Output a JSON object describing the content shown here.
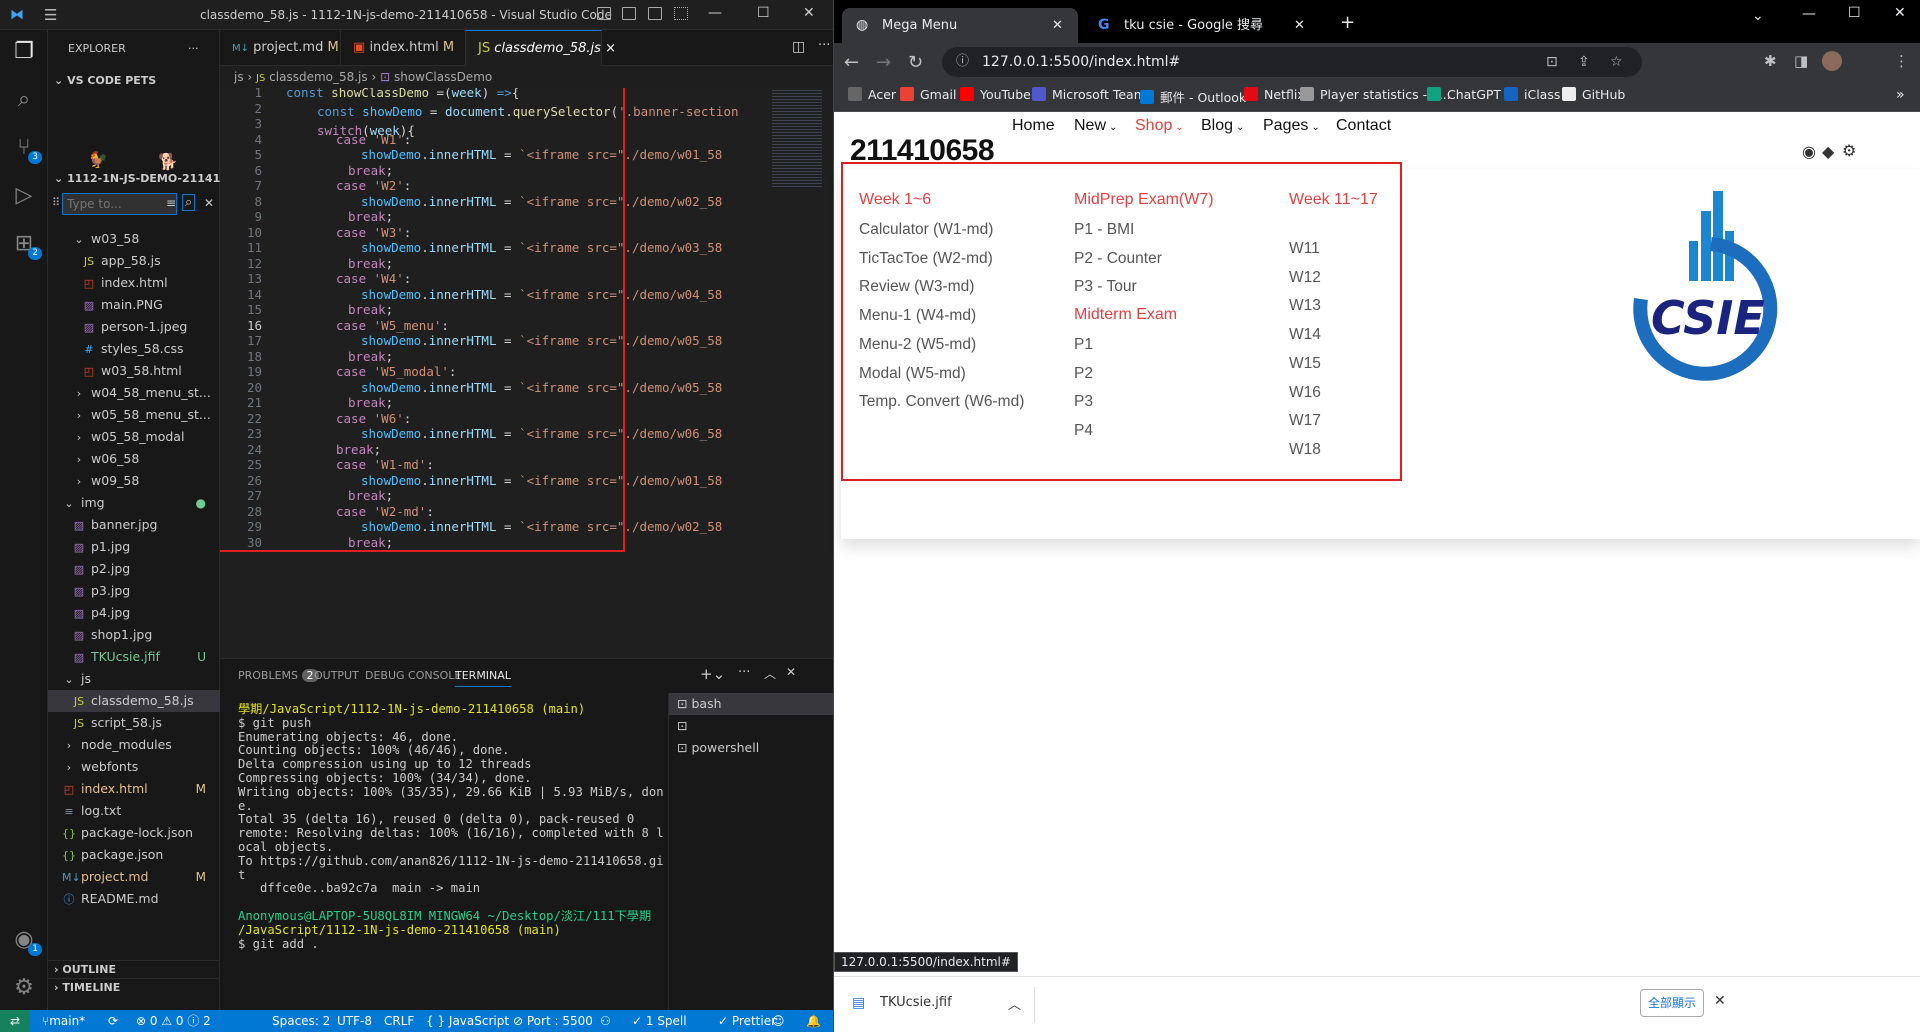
{
  "vscode": {
    "title": "classdemo_58.js - 1112-1N-js-demo-211410658 - Visual Studio Code",
    "explorer": {
      "header": "EXPLORER",
      "more": "···",
      "section": "VS CODE PETS",
      "project": "1112-1N-JS-DEMO-21141...",
      "filter_placeholder": "Type to...",
      "tree": [
        {
          "label": "w03_58",
          "type": "folder-open",
          "indent": 1,
          "mark": ""
        },
        {
          "label": "app_58.js",
          "type": "js",
          "indent": 2,
          "mark": ""
        },
        {
          "label": "index.html",
          "type": "html",
          "indent": 2,
          "mark": ""
        },
        {
          "label": "main.PNG",
          "type": "img",
          "indent": 2,
          "mark": ""
        },
        {
          "label": "person-1.jpeg",
          "type": "img",
          "indent": 2,
          "mark": ""
        },
        {
          "label": "styles_58.css",
          "type": "css",
          "indent": 2,
          "mark": ""
        },
        {
          "label": "w03_58.html",
          "type": "html",
          "indent": 2,
          "mark": ""
        },
        {
          "label": "w04_58_menu_st...",
          "type": "folder",
          "indent": 1,
          "mark": ""
        },
        {
          "label": "w05_58_menu_st...",
          "type": "folder",
          "indent": 1,
          "mark": ""
        },
        {
          "label": "w05_58_modal",
          "type": "folder",
          "indent": 1,
          "mark": ""
        },
        {
          "label": "w06_58",
          "type": "folder",
          "indent": 1,
          "mark": ""
        },
        {
          "label": "w09_58",
          "type": "folder",
          "indent": 1,
          "mark": ""
        },
        {
          "label": "img",
          "type": "folder-open",
          "indent": 0,
          "mark": "●"
        },
        {
          "label": "banner.jpg",
          "type": "img",
          "indent": 1,
          "mark": ""
        },
        {
          "label": "p1.jpg",
          "type": "img",
          "indent": 1,
          "mark": ""
        },
        {
          "label": "p2.jpg",
          "type": "img",
          "indent": 1,
          "mark": ""
        },
        {
          "label": "p3.jpg",
          "type": "img",
          "indent": 1,
          "mark": ""
        },
        {
          "label": "p4.jpg",
          "type": "img",
          "indent": 1,
          "mark": ""
        },
        {
          "label": "shop1.jpg",
          "type": "img",
          "indent": 1,
          "mark": ""
        },
        {
          "label": "TKUcsie.jfif",
          "type": "img",
          "indent": 1,
          "mark": "U"
        },
        {
          "label": "js",
          "type": "folder-open",
          "indent": 0,
          "mark": ""
        },
        {
          "label": "classdemo_58.js",
          "type": "js",
          "indent": 1,
          "mark": "",
          "sel": true
        },
        {
          "label": "script_58.js",
          "type": "js",
          "indent": 1,
          "mark": ""
        },
        {
          "label": "node_modules",
          "type": "folder",
          "indent": 0,
          "mark": ""
        },
        {
          "label": "webfonts",
          "type": "folder",
          "indent": 0,
          "mark": ""
        },
        {
          "label": "index.html",
          "type": "html",
          "indent": 0,
          "mark": "M"
        },
        {
          "label": "log.txt",
          "type": "txt",
          "indent": 0,
          "mark": ""
        },
        {
          "label": "package-lock.json",
          "type": "json",
          "indent": 0,
          "mark": ""
        },
        {
          "label": "package.json",
          "type": "json",
          "indent": 0,
          "mark": ""
        },
        {
          "label": "project.md",
          "type": "md",
          "indent": 0,
          "mark": "M"
        },
        {
          "label": "README.md",
          "type": "info",
          "indent": 0,
          "mark": ""
        }
      ],
      "outline": "OUTLINE",
      "timeline": "TIMELINE"
    },
    "tabs": [
      {
        "label": "project.md",
        "mark": "M"
      },
      {
        "label": "index.html",
        "mark": "M"
      },
      {
        "label": "classdemo_58.js",
        "mark": "×"
      }
    ],
    "breadcrumb": {
      "a": "js",
      "b": "classdemo_58.js",
      "c": "showClassDemo"
    },
    "code_lines": [
      "1",
      "2",
      "3",
      "4",
      "5",
      "6",
      "7",
      "8",
      "9",
      "10",
      "11",
      "12",
      "13",
      "14",
      "15",
      "16",
      "17",
      "18",
      "19",
      "20",
      "21",
      "22",
      "23",
      "24",
      "25",
      "26",
      "27",
      "28",
      "29",
      "30"
    ],
    "panel": {
      "tabs": [
        "PROBLEMS",
        "OUTPUT",
        "DEBUG CONSOLE",
        "TERMINAL"
      ],
      "problems_count": "2",
      "terminal": [
        "學期/JavaScript/1112-1N-js-demo-211410658 (main)",
        "$ git push",
        "Enumerating objects: 46, done.",
        "Counting objects: 100% (46/46), done.",
        "Delta compression using up to 12 threads",
        "Compressing objects: 100% (34/34), done.",
        "Writing objects: 100% (35/35), 29.66 KiB | 5.93 MiB/s, don",
        "e.",
        "Total 35 (delta 16), reused 0 (delta 0), pack-reused 0",
        "remote: Resolving deltas: 100% (16/16), completed with 8 l",
        "ocal objects.",
        "To https://github.com/anan826/1112-1N-js-demo-211410658.gi",
        "t",
        "   dffce0e..ba92c7a  main -> main",
        "",
        "Anonymous@LAPTOP-5U8QL8IM MINGW64 ~/Desktop/淡江/111下學期",
        "/JavaScript/1112-1N-js-demo-211410658 (main)",
        "$ git add ."
      ],
      "shells": [
        "bash",
        "powershell"
      ]
    },
    "status": {
      "branch": "main*",
      "sync": "⟳",
      "errors": "⊗ 0 ⚠ 0 ⓘ 2",
      "spaces": "Spaces: 2",
      "encoding": "UTF-8",
      "eol": "CRLF",
      "lang": "{ } JavaScript",
      "port": "⊘ Port : 5500",
      "spell": "✓ 1 Spell",
      "prettier": "✓ Prettier"
    }
  },
  "chrome": {
    "tabs": [
      "Mega Menu",
      "tku csie - Google 搜尋"
    ],
    "url": "127.0.0.1:5500/index.html#",
    "bookmarks": [
      "Acer",
      "Gmail",
      "YouTube",
      "Microsoft Teams",
      "郵件 - Outlook",
      "Netflix",
      "Player statistics - a...",
      "ChatGPT",
      "iClass",
      "GitHub"
    ],
    "site": {
      "brand": "211410658",
      "nav": [
        {
          "label": "Home",
          "caret": false,
          "active": false
        },
        {
          "label": "New",
          "caret": true,
          "active": false
        },
        {
          "label": "Shop",
          "caret": true,
          "active": true
        },
        {
          "label": "Blog",
          "caret": true,
          "active": false
        },
        {
          "label": "Pages",
          "caret": true,
          "active": false
        },
        {
          "label": "Contact",
          "caret": false,
          "active": false
        }
      ],
      "col1": {
        "title": "Week 1~6",
        "links": [
          "Calculator (W1-md)",
          "TicTacToe (W2-md)",
          "Review (W3-md)",
          "Menu-1 (W4-md)",
          "Menu-2 (W5-md)",
          "Modal (W5-md)",
          "Temp. Convert (W6-md)"
        ]
      },
      "col2": {
        "title": "MidPrep Exam(W7)",
        "links": [
          "P1 - BMI",
          "P2 - Counter",
          "P3 - Tour"
        ],
        "title2": "Midterm Exam",
        "links2": [
          "P1",
          "P2",
          "P3",
          "P4"
        ]
      },
      "col3": {
        "title": "Week 11~17",
        "links": [
          "W11",
          "W12",
          "W13",
          "W14",
          "W15",
          "W16",
          "W17",
          "W18"
        ]
      },
      "logo_text": "CSIE"
    },
    "status_url": "127.0.0.1:5500/index.html#",
    "download": {
      "file": "TKUcsie.jfif",
      "show_all": "全部顯示"
    }
  }
}
